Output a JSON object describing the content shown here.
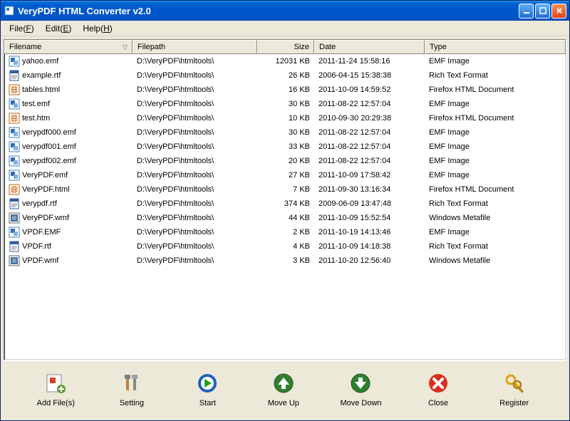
{
  "window": {
    "title": "VeryPDF HTML Converter v2.0"
  },
  "menu": {
    "file": "File(F)",
    "edit": "Edit(E)",
    "help": "Help(H)"
  },
  "columns": {
    "filename": "Filename",
    "filepath": "Filepath",
    "size": "Size",
    "date": "Date",
    "type": "Type"
  },
  "files": [
    {
      "icon": "emf",
      "name": "yahoo.emf",
      "path": "D:\\VeryPDF\\htmltools\\",
      "size": "12031 KB",
      "date": "2011-11-24 15:58:16",
      "type": "EMF Image"
    },
    {
      "icon": "rtf",
      "name": "example.rtf",
      "path": "D:\\VeryPDF\\htmltools\\",
      "size": "26 KB",
      "date": "2006-04-15 15:38:38",
      "type": "Rich Text Format"
    },
    {
      "icon": "html",
      "name": "tables.html",
      "path": "D:\\VeryPDF\\htmltools\\",
      "size": "16 KB",
      "date": "2011-10-09 14:59:52",
      "type": "Firefox HTML Document"
    },
    {
      "icon": "emf",
      "name": "test.emf",
      "path": "D:\\VeryPDF\\htmltools\\",
      "size": "30 KB",
      "date": "2011-08-22 12:57:04",
      "type": "EMF Image"
    },
    {
      "icon": "html",
      "name": "test.htm",
      "path": "D:\\VeryPDF\\htmltools\\",
      "size": "10 KB",
      "date": "2010-09-30 20:29:38",
      "type": "Firefox HTML Document"
    },
    {
      "icon": "emf",
      "name": "verypdf000.emf",
      "path": "D:\\VeryPDF\\htmltools\\",
      "size": "30 KB",
      "date": "2011-08-22 12:57:04",
      "type": "EMF Image"
    },
    {
      "icon": "emf",
      "name": "verypdf001.emf",
      "path": "D:\\VeryPDF\\htmltools\\",
      "size": "33 KB",
      "date": "2011-08-22 12:57:04",
      "type": "EMF Image"
    },
    {
      "icon": "emf",
      "name": "verypdf002.emf",
      "path": "D:\\VeryPDF\\htmltools\\",
      "size": "20 KB",
      "date": "2011-08-22 12:57:04",
      "type": "EMF Image"
    },
    {
      "icon": "emf",
      "name": "VeryPDF.emf",
      "path": "D:\\VeryPDF\\htmltools\\",
      "size": "27 KB",
      "date": "2011-10-09 17:58:42",
      "type": "EMF Image"
    },
    {
      "icon": "html",
      "name": "VeryPDF.html",
      "path": "D:\\VeryPDF\\htmltools\\",
      "size": "7 KB",
      "date": "2011-09-30 13:16:34",
      "type": "Firefox HTML Document"
    },
    {
      "icon": "rtf",
      "name": "verypdf.rtf",
      "path": "D:\\VeryPDF\\htmltools\\",
      "size": "374 KB",
      "date": "2009-06-09 13:47:48",
      "type": "Rich Text Format"
    },
    {
      "icon": "wmf",
      "name": "VeryPDF.wmf",
      "path": "D:\\VeryPDF\\htmltools\\",
      "size": "44 KB",
      "date": "2011-10-09 15:52:54",
      "type": "Windows Metafile"
    },
    {
      "icon": "emf",
      "name": "VPDF.EMF",
      "path": "D:\\VeryPDF\\htmltools\\",
      "size": "2 KB",
      "date": "2011-10-19 14:13:46",
      "type": "EMF Image"
    },
    {
      "icon": "rtf",
      "name": "VPDF.rtf",
      "path": "D:\\VeryPDF\\htmltools\\",
      "size": "4 KB",
      "date": "2011-10-09 14:18:38",
      "type": "Rich Text Format"
    },
    {
      "icon": "wmf",
      "name": "VPDF.wmf",
      "path": "D:\\VeryPDF\\htmltools\\",
      "size": "3 KB",
      "date": "2011-10-20 12:56:40",
      "type": "Windows Metafile"
    }
  ],
  "toolbar": {
    "addfiles": "Add File(s)",
    "setting": "Setting",
    "start": "Start",
    "moveup": "Move Up",
    "movedown": "Move Down",
    "close": "Close",
    "register": "Register"
  }
}
